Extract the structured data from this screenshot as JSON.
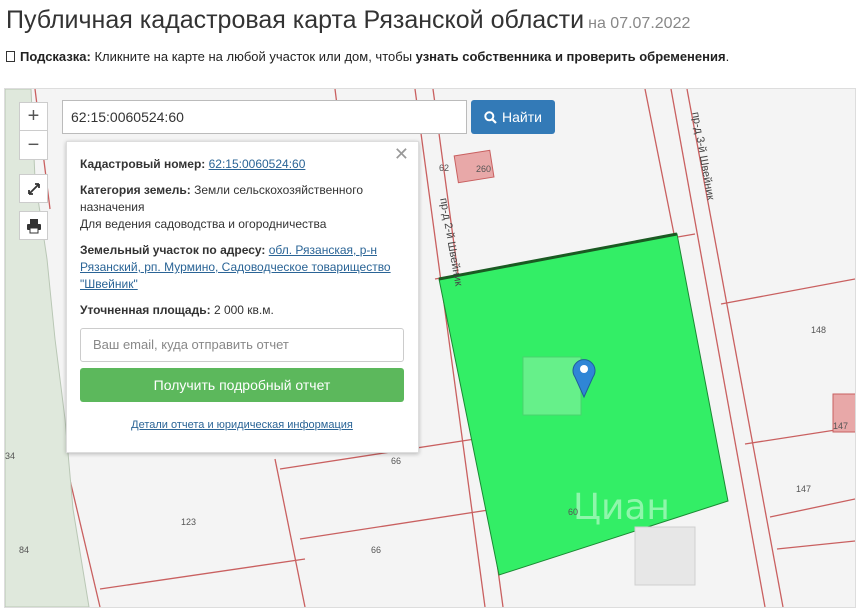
{
  "header": {
    "title": "Публичная кадастровая карта Рязанской области",
    "date": "на 07.07.2022"
  },
  "hint": {
    "label": "Подсказка:",
    "text": " Кликните на карте на любой участок или дом, чтобы ",
    "bold": "узнать собственника и проверить обременения",
    "end": "."
  },
  "controls": {
    "zoom_in": "+",
    "zoom_out": "−"
  },
  "search": {
    "value": "62:15:0060524:60",
    "button_label": "Найти"
  },
  "popup": {
    "cad_label": "Кадастровый номер:",
    "cad_value": "62:15:0060524:60",
    "category_label": "Категория земель:",
    "category_value": "Земли сельскохозяйственного назначения",
    "usage": "Для ведения садоводства и огородничества",
    "address_label": "Земельный участок по адресу:",
    "address_value": "обл. Рязанская, р-н Рязанский, рп. Мурмино, Садоводческое товарищество \"Швейник\"",
    "area_label": "Уточненная площадь:",
    "area_value": "2 000 кв.м.",
    "email_placeholder": "Ваш email, куда отправить отчет",
    "report_button": "Получить подробный отчет",
    "details_link": "Детали отчета и юридическая информация"
  },
  "map": {
    "streets": {
      "street_2": "пр-д 2-й Швейник",
      "street_3": "пр-д 3-й Швейник"
    },
    "plots": [
      "62",
      "260",
      "148",
      "147",
      "147",
      "66",
      "123",
      "66",
      "60",
      "84",
      "34"
    ],
    "watermark": "Циан",
    "colors": {
      "parcel": "#33ee66",
      "boundary": "#c96060",
      "marker": "#2f86d6"
    }
  }
}
